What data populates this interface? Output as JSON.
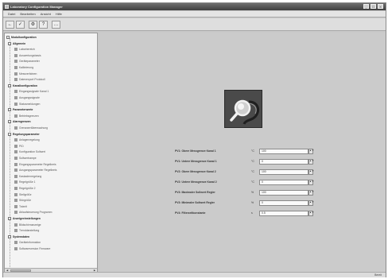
{
  "window": {
    "title": "Laboratory  Configuration  Manager"
  },
  "window_controls": [
    "_",
    "□",
    "×"
  ],
  "menu": [
    "Datei",
    "Bearbeiten",
    "Ansicht",
    "Hilfe"
  ],
  "toolbar": {
    "buttons": [
      "←",
      "✓",
      "⚙",
      "?",
      "…"
    ]
  },
  "tree": [
    {
      "label": "Modulkonfiguration",
      "kind": "root"
    },
    {
      "label": "Allgemein",
      "kind": "group"
    },
    {
      "label": "Laborbereich",
      "kind": "leaf"
    },
    {
      "label": "Auswertungsbasis",
      "kind": "leaf"
    },
    {
      "label": "Geräteparameter",
      "kind": "leaf"
    },
    {
      "label": "Kalibrierung",
      "kind": "leaf"
    },
    {
      "label": "Messverfahren",
      "kind": "leaf"
    },
    {
      "label": "Datenexport Protokoll",
      "kind": "leaf"
    },
    {
      "label": "Kanalkonfiguration",
      "kind": "group"
    },
    {
      "label": "Eingangssignale Kanal 1",
      "kind": "leaf"
    },
    {
      "label": "Ausgangssignale",
      "kind": "leaf"
    },
    {
      "label": "Statusmeldungen",
      "kind": "leaf"
    },
    {
      "label": "Parameterwerte",
      "kind": "group"
    },
    {
      "label": "Betriebsgrenzen",
      "kind": "leaf"
    },
    {
      "label": "Alarmgrenzen",
      "kind": "group"
    },
    {
      "label": "Grenzwertüberwachung",
      "kind": "leaf"
    },
    {
      "label": "Regelungsparameter",
      "kind": "group"
    },
    {
      "label": "Anlagenregelung",
      "kind": "leaf"
    },
    {
      "label": "PID",
      "kind": "leaf"
    },
    {
      "label": "Konfiguration Sollwert",
      "kind": "leaf"
    },
    {
      "label": "Sollwertrampe",
      "kind": "leaf"
    },
    {
      "label": "Eingangsparameter Regelkreis",
      "kind": "leaf"
    },
    {
      "label": "Ausgangsparameter Regelkreis",
      "kind": "leaf"
    },
    {
      "label": "Kaskadenregelung",
      "kind": "leaf"
    },
    {
      "label": "Regelgröße 1",
      "kind": "leaf"
    },
    {
      "label": "Regelgröße 2",
      "kind": "leaf"
    },
    {
      "label": "Stellgröße",
      "kind": "leaf"
    },
    {
      "label": "Störgröße",
      "kind": "leaf"
    },
    {
      "label": "Totzeit",
      "kind": "leaf"
    },
    {
      "label": "Ablaufsteuerung Programm",
      "kind": "leaf"
    },
    {
      "label": "Anzeigeeinstellungen",
      "kind": "group"
    },
    {
      "label": "Bildschirmanzeige",
      "kind": "leaf"
    },
    {
      "label": "Trenddarstellung",
      "kind": "leaf"
    },
    {
      "label": "Systemdaten",
      "kind": "group"
    },
    {
      "label": "Geräteinformation",
      "kind": "leaf"
    },
    {
      "label": "Softwareversion Firmware",
      "kind": "leaf"
    }
  ],
  "parameters": [
    {
      "label": "PV1: Obere Messgrenze Kanal 1",
      "unit": "°C",
      "value": "100"
    },
    {
      "label": "PV1: Untere Messgrenze Kanal 1",
      "unit": "°C",
      "value": "0"
    },
    {
      "label": "PV2: Obere Messgrenze Kanal 2",
      "unit": "°C",
      "value": "100"
    },
    {
      "label": "PV2: Untere Messgrenze Kanal 2",
      "unit": "°C",
      "value": "0"
    },
    {
      "label": "PV3: Maximaler Sollwert Regler",
      "unit": "%",
      "value": "100"
    },
    {
      "label": "PV3: Minimaler Sollwert Regler",
      "unit": "%",
      "value": "0"
    },
    {
      "label": "PV4: Filterzeitkonstante",
      "unit": "s",
      "value": "0.5"
    }
  ],
  "spin_glyph": "▲▼",
  "status": {
    "right": "Bereit"
  },
  "scroll": {
    "left": "◀",
    "right": "▶"
  },
  "colors": {
    "titlebar": "#4f4f4f",
    "workspace": "#cbcbcb",
    "selection": "#7b8ea8"
  },
  "icons": {
    "hero": "magnifier-cable-icon"
  }
}
